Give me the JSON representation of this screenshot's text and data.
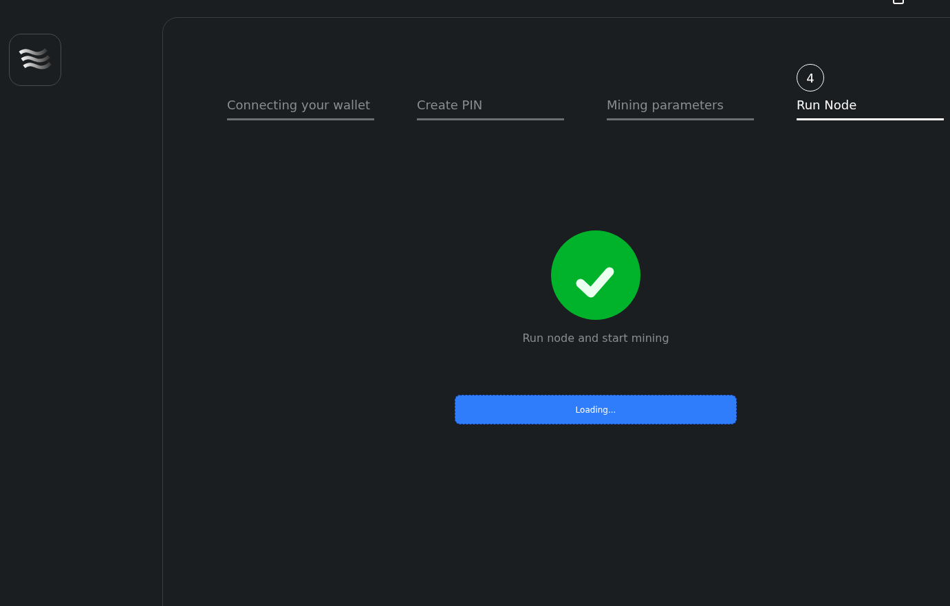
{
  "steps": [
    {
      "label": "Connecting your wallet",
      "selected": false
    },
    {
      "label": "Create PIN",
      "selected": false
    },
    {
      "label": "Mining parameters",
      "selected": false
    },
    {
      "label": "Run Node",
      "selected": true,
      "number": "4"
    }
  ],
  "status": {
    "message": "Run node and start mining"
  },
  "button": {
    "label": "Loading..."
  }
}
